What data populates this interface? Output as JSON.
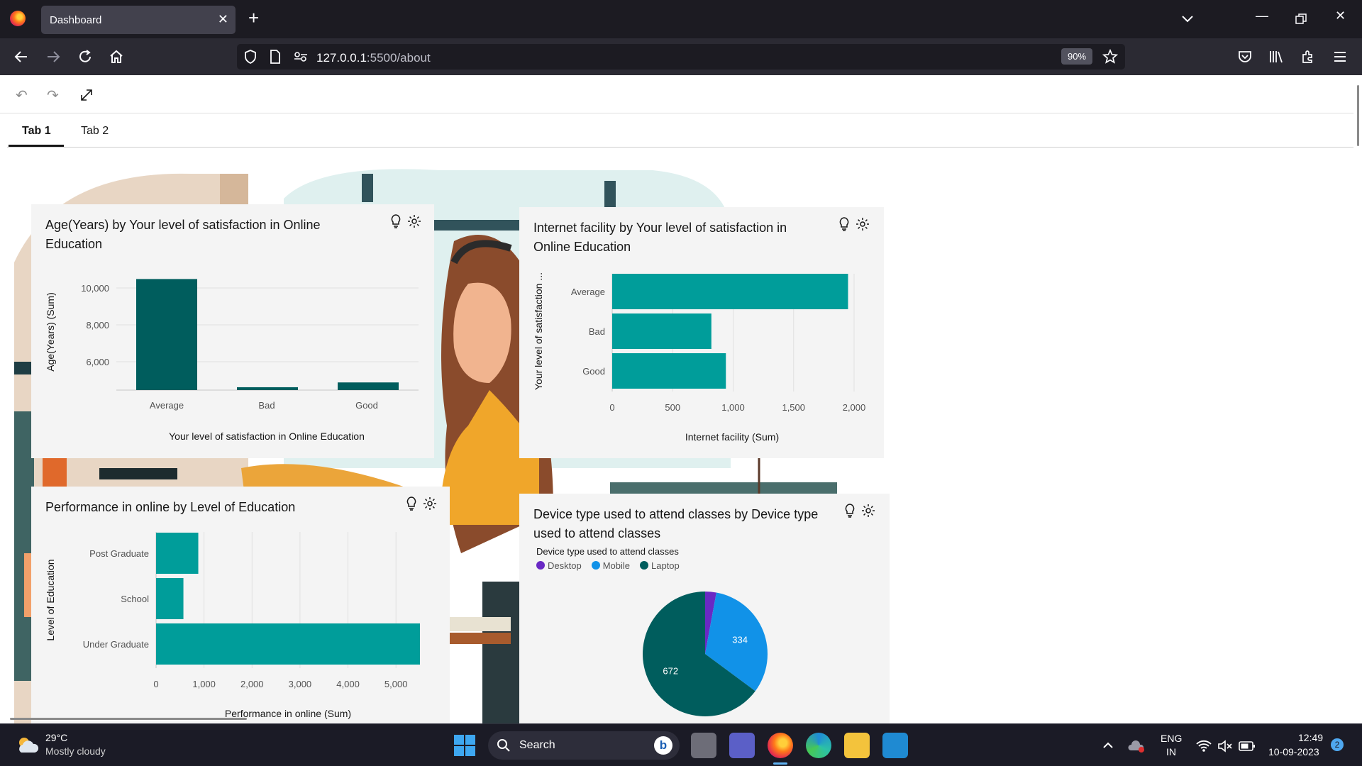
{
  "browser": {
    "tab_title": "Dashboard",
    "url_host": "127.0.0.1",
    "url_path": ":5500/about",
    "zoom": "90%"
  },
  "page": {
    "tabs": [
      "Tab 1",
      "Tab 2"
    ],
    "active_tab": "Tab 1"
  },
  "charts": {
    "age": {
      "title_line1": "Age(Years) by Your level of satisfaction in Online",
      "title_line2": "Education",
      "ylabel": "Age(Years) (Sum)",
      "xlabel": "Your level of satisfaction in Online Education",
      "yticks": [
        "10,000",
        "8,000",
        "6,000"
      ],
      "categories": [
        "Average",
        "Bad",
        "Good"
      ]
    },
    "internet": {
      "title_line1": "Internet facility by Your level of satisfaction in",
      "title_line2": "Online Education",
      "ylabel": "Your level of satisfaction ...",
      "xlabel": "Internet facility (Sum)",
      "xticks": [
        "0",
        "500",
        "1,000",
        "1,500",
        "2,000"
      ],
      "categories": [
        "Average",
        "Bad",
        "Good"
      ]
    },
    "performance": {
      "title": "Performance in online by Level of Education",
      "ylabel": "Level of Education",
      "xlabel": "Performance in online (Sum)",
      "xticks": [
        "0",
        "1,000",
        "2,000",
        "3,000",
        "4,000",
        "5,000"
      ],
      "categories": [
        "Post Graduate",
        "School",
        "Under Graduate"
      ]
    },
    "device": {
      "title_line1": "Device type used to attend classes by Device type",
      "title_line2": "used to attend classes",
      "legend_title": "Device type used to attend classes",
      "legend": [
        "Desktop",
        "Mobile",
        "Laptop"
      ],
      "slice_labels": [
        "334",
        "672"
      ]
    }
  },
  "chart_data": [
    {
      "type": "bar",
      "title": "Age(Years) by Your level of satisfaction in Online Education",
      "categories": [
        "Average",
        "Bad",
        "Good"
      ],
      "values": [
        10600,
        4950,
        5200
      ],
      "xlabel": "Your level of satisfaction in Online Education",
      "ylabel": "Age(Years) (Sum)",
      "ylim": [
        4800,
        10800
      ],
      "grid": true,
      "color": "#005d5d"
    },
    {
      "type": "bar",
      "orientation": "horizontal",
      "title": "Internet facility by Your level of satisfaction in Online Education",
      "categories": [
        "Average",
        "Bad",
        "Good"
      ],
      "values": [
        1950,
        820,
        940
      ],
      "xlabel": "Internet facility (Sum)",
      "ylabel": "Your level of satisfaction ...",
      "xlim": [
        0,
        2000
      ],
      "grid": true,
      "color": "#009d9a"
    },
    {
      "type": "bar",
      "orientation": "horizontal",
      "title": "Performance in online by Level of Education",
      "categories": [
        "Post Graduate",
        "School",
        "Under Graduate"
      ],
      "values": [
        880,
        570,
        5500
      ],
      "xlabel": "Performance in online (Sum)",
      "ylabel": "Level of Education",
      "xlim": [
        0,
        5500
      ],
      "grid": true,
      "color": "#009d9a"
    },
    {
      "type": "pie",
      "title": "Device type used to attend classes by Device type used to attend classes",
      "categories": [
        "Desktop",
        "Mobile",
        "Laptop"
      ],
      "values": [
        30,
        334,
        672
      ],
      "colors": [
        "#6929c4",
        "#1192e8",
        "#005d5d"
      ],
      "legend": "top-left"
    }
  ],
  "taskbar": {
    "weather_temp": "29°C",
    "weather_desc": "Mostly cloudy",
    "search_label": "Search",
    "lang1": "ENG",
    "lang2": "IN",
    "time": "12:49",
    "date": "10-09-2023",
    "notif_count": "2"
  }
}
